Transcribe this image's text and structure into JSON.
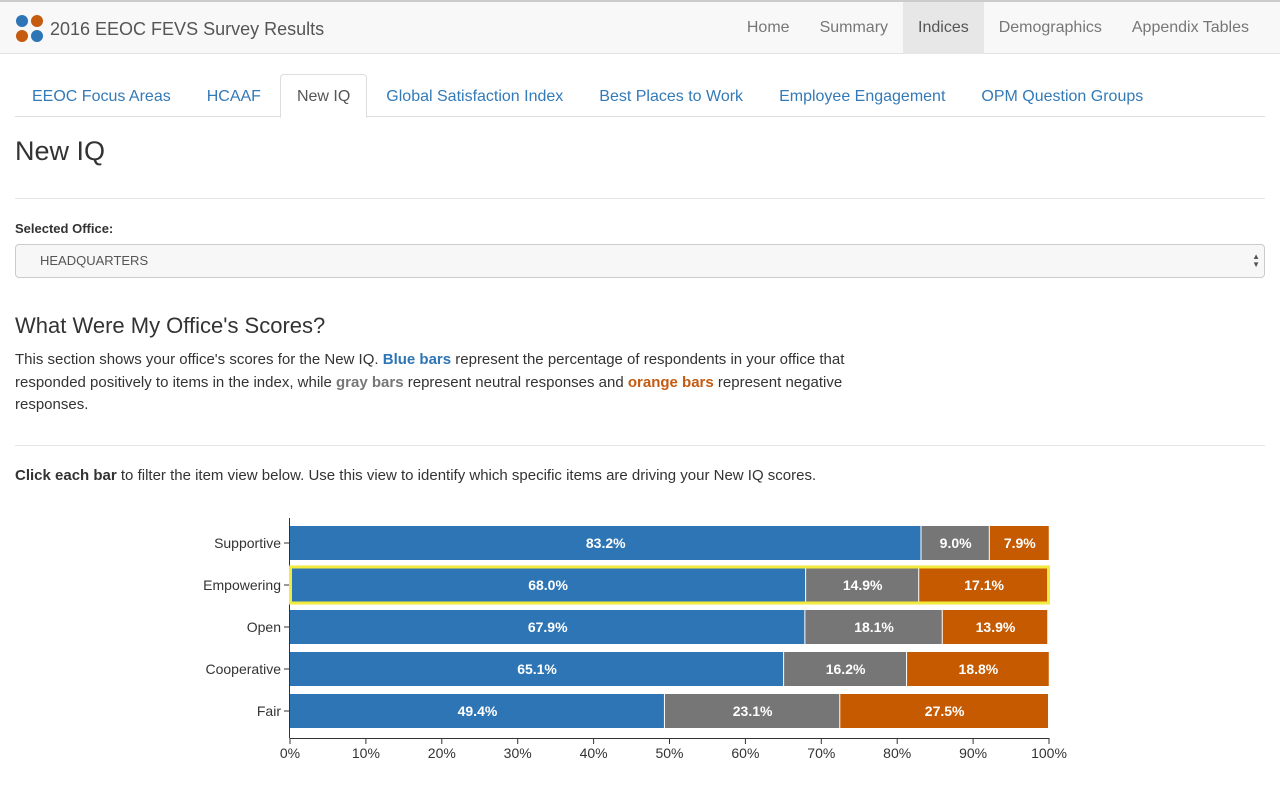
{
  "navbar": {
    "title": "2016 EEOC FEVS Survey Results",
    "logo_colors": [
      "#2e75b6",
      "#c55a11",
      "#c55a11",
      "#2e75b6"
    ],
    "items": [
      {
        "label": "Home",
        "active": false
      },
      {
        "label": "Summary",
        "active": false
      },
      {
        "label": "Indices",
        "active": true
      },
      {
        "label": "Demographics",
        "active": false
      },
      {
        "label": "Appendix Tables",
        "active": false
      }
    ]
  },
  "tabs": [
    {
      "label": "EEOC Focus Areas",
      "active": false
    },
    {
      "label": "HCAAF",
      "active": false
    },
    {
      "label": "New IQ",
      "active": true
    },
    {
      "label": "Global Satisfaction Index",
      "active": false
    },
    {
      "label": "Best Places to Work",
      "active": false
    },
    {
      "label": "Employee Engagement",
      "active": false
    },
    {
      "label": "OPM Question Groups",
      "active": false
    }
  ],
  "page": {
    "title": "New IQ",
    "office_label": "Selected Office:",
    "office_value": "HEADQUARTERS",
    "section_title": "What Were My Office's Scores?",
    "desc": {
      "p1": "This section shows your office's scores for the New IQ. ",
      "blue": "Blue bars",
      "p2": " represent the percentage of respondents in your office that responded positively to items in the index, while ",
      "gray": "gray bars",
      "p3": " represent neutral responses and ",
      "orange": "orange bars",
      "p4": " represent negative responses."
    },
    "click_bold": "Click each bar",
    "click_rest": " to filter the item view below. Use this view to identify which specific items are driving your New IQ scores."
  },
  "colors": {
    "positive": "#2e75b6",
    "neutral": "#767676",
    "negative": "#c55a00",
    "highlight": "#f2ea3c"
  },
  "chart_data": {
    "type": "bar",
    "orientation": "horizontal",
    "stacked": true,
    "categories": [
      "Supportive",
      "Empowering",
      "Open",
      "Cooperative",
      "Fair"
    ],
    "series": [
      {
        "values": [
          83.2,
          68.0,
          67.9,
          65.1,
          49.4
        ]
      },
      {
        "values": [
          9.0,
          14.9,
          18.1,
          16.2,
          23.1
        ]
      },
      {
        "values": [
          7.9,
          17.1,
          13.9,
          18.8,
          27.5
        ]
      }
    ],
    "data_labels": [
      [
        "83.2%",
        "9.0%",
        "7.9%"
      ],
      [
        "68.0%",
        "14.9%",
        "17.1%"
      ],
      [
        "67.9%",
        "18.1%",
        "13.9%"
      ],
      [
        "65.1%",
        "16.2%",
        "18.8%"
      ],
      [
        "49.4%",
        "23.1%",
        "27.5%"
      ]
    ],
    "selected_category": "Empowering",
    "xlim": [
      0,
      100
    ],
    "xticks": [
      "0%",
      "10%",
      "20%",
      "30%",
      "40%",
      "50%",
      "60%",
      "70%",
      "80%",
      "90%",
      "100%"
    ],
    "grid": false,
    "legend": "none"
  }
}
